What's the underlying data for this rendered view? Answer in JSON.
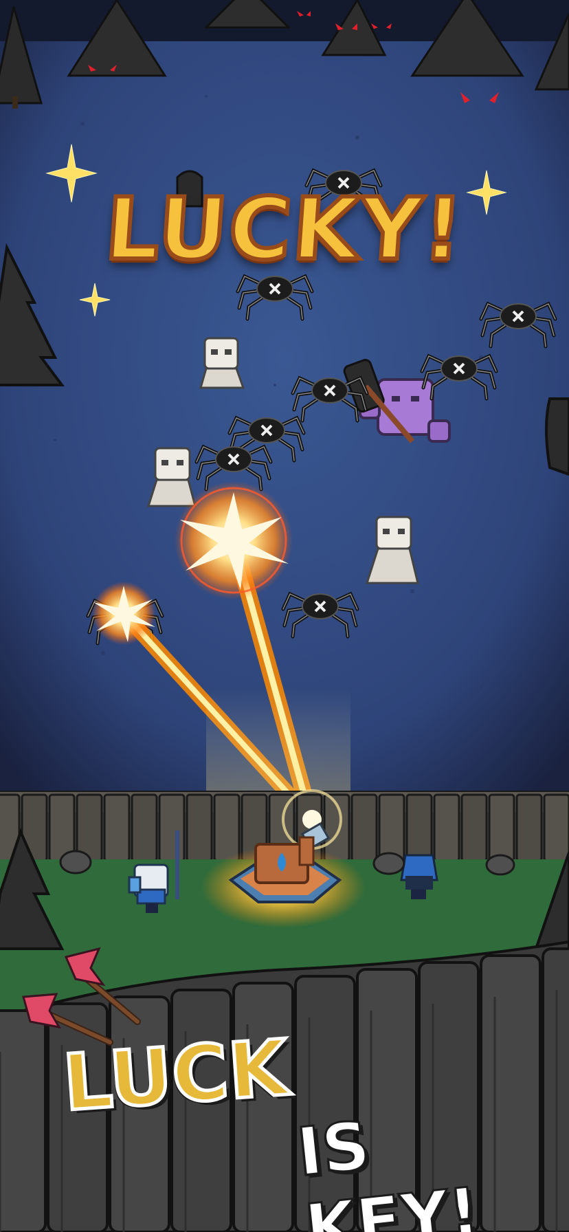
{
  "banner": {
    "text": "LUCKY!"
  },
  "tagline": {
    "line1": "LUCK",
    "line2": "IS KEY!"
  },
  "colors": {
    "field": "#34508a",
    "field_dark": "#1d2745",
    "grass": "#2e6a3a",
    "wall": "#3b3b3b",
    "laser": "#ffb22e",
    "banner_fill": "#f6c23e",
    "banner_outline": "#9a4b1a",
    "spider": "#1c1c1c",
    "skeleton": "#e9e6df",
    "ogre": "#a77ad6"
  }
}
